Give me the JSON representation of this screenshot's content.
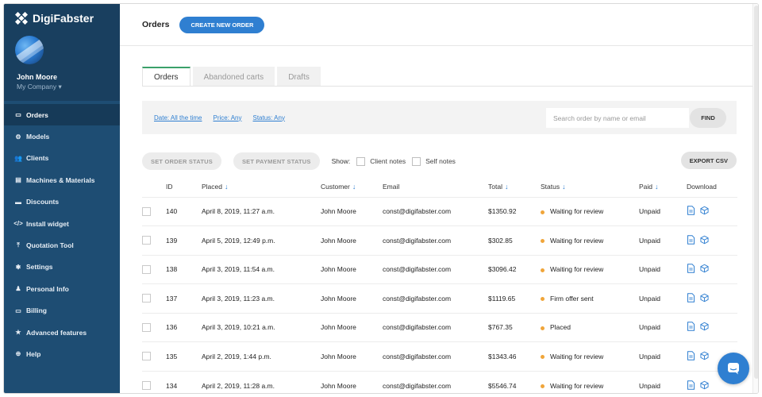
{
  "brand": {
    "name": "DigiFabster"
  },
  "user": {
    "name": "John Moore",
    "company": "My Company"
  },
  "sidebar": {
    "items": [
      {
        "label": "Orders",
        "icon": "orders-icon",
        "glyph": "▭"
      },
      {
        "label": "Models",
        "icon": "models-icon",
        "glyph": "⚙"
      },
      {
        "label": "Clients",
        "icon": "clients-icon",
        "glyph": "👥"
      },
      {
        "label": "Machines & Materials",
        "icon": "machines-icon",
        "glyph": "▤"
      },
      {
        "label": "Discounts",
        "icon": "discounts-icon",
        "glyph": "▬"
      },
      {
        "label": "Install widget",
        "icon": "code-icon",
        "glyph": "</>"
      },
      {
        "label": "Quotation Tool",
        "icon": "upload-icon",
        "glyph": "⤒"
      },
      {
        "label": "Settings",
        "icon": "gear-icon",
        "glyph": "✱"
      },
      {
        "label": "Personal Info",
        "icon": "person-icon",
        "glyph": "♟"
      },
      {
        "label": "Billing",
        "icon": "card-icon",
        "glyph": "▭"
      },
      {
        "label": "Advanced features",
        "icon": "star-icon",
        "glyph": "★"
      },
      {
        "label": "Help",
        "icon": "help-icon",
        "glyph": "⊕"
      }
    ]
  },
  "header": {
    "title": "Orders",
    "create_label": "CREATE NEW ORDER"
  },
  "tabs": [
    {
      "label": "Orders"
    },
    {
      "label": "Abandoned carts"
    },
    {
      "label": "Drafts"
    }
  ],
  "filters": {
    "date": "Date: All the time",
    "price": "Price: Any",
    "status": "Status: Any",
    "search_placeholder": "Search order by name or email",
    "find_label": "FIND"
  },
  "actions": {
    "set_order_status": "SET ORDER STATUS",
    "set_payment_status": "SET PAYMENT STATUS",
    "show_label": "Show:",
    "client_notes": "Client notes",
    "self_notes": "Self notes",
    "export_label": "EXPORT CSV"
  },
  "table": {
    "columns": {
      "id": "ID",
      "placed": "Placed",
      "customer": "Customer",
      "email": "Email",
      "total": "Total",
      "status": "Status",
      "paid": "Paid",
      "download": "Download"
    },
    "rows": [
      {
        "id": "140",
        "placed": "April 8, 2019, 11:27 a.m.",
        "customer": "John Moore",
        "email": "const@digifabster.com",
        "total": "$1350.92",
        "status": "Waiting for review",
        "paid": "Unpaid"
      },
      {
        "id": "139",
        "placed": "April 5, 2019, 12:49 p.m.",
        "customer": "John Moore",
        "email": "const@digifabster.com",
        "total": "$302.85",
        "status": "Waiting for review",
        "paid": "Unpaid"
      },
      {
        "id": "138",
        "placed": "April 3, 2019, 11:54 a.m.",
        "customer": "John Moore",
        "email": "const@digifabster.com",
        "total": "$3096.42",
        "status": "Waiting for review",
        "paid": "Unpaid"
      },
      {
        "id": "137",
        "placed": "April 3, 2019, 11:23 a.m.",
        "customer": "John Moore",
        "email": "const@digifabster.com",
        "total": "$1119.65",
        "status": "Firm offer sent",
        "paid": "Unpaid"
      },
      {
        "id": "136",
        "placed": "April 3, 2019, 10:21 a.m.",
        "customer": "John Moore",
        "email": "const@digifabster.com",
        "total": "$767.35",
        "status": "Placed",
        "paid": "Unpaid"
      },
      {
        "id": "135",
        "placed": "April 2, 2019, 1:44 p.m.",
        "customer": "John Moore",
        "email": "const@digifabster.com",
        "total": "$1343.46",
        "status": "Waiting for review",
        "paid": "Unpaid"
      },
      {
        "id": "134",
        "placed": "April 2, 2019, 11:28 a.m.",
        "customer": "John Moore",
        "email": "const@digifabster.com",
        "total": "$5546.74",
        "status": "Waiting for review",
        "paid": "Unpaid"
      }
    ]
  },
  "colors": {
    "sidebar": "#1e4d73",
    "accent": "#2f7fd1",
    "status_dot": "#f0a53a",
    "tab_active": "#3aa06a"
  }
}
